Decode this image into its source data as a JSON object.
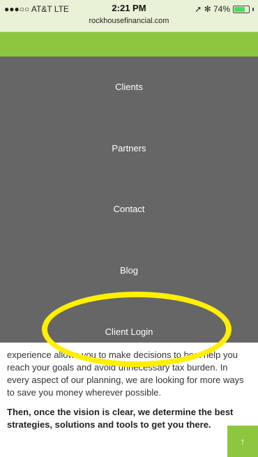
{
  "status_bar": {
    "carrier": "●●●○○ AT&T LTE",
    "time": "2:21 PM",
    "url": "rockhousefinancial.com",
    "indicators": "➚ ✻ 74%",
    "battery_percent": 74
  },
  "menu": {
    "items": [
      {
        "label": "Clients"
      },
      {
        "label": "Partners"
      },
      {
        "label": "Contact"
      },
      {
        "label": "Blog"
      },
      {
        "label": "Client Login"
      }
    ]
  },
  "content": {
    "paragraph1": "experience allows you to make decisions to best help you reach your goals and avoid unnecessary tax burden. In every aspect of our planning, we are looking for more ways to save you money wherever possible.",
    "paragraph2": "Then, once the vision is clear, we determine the best strategies, solutions and tools to get you there."
  },
  "scroll_top": {
    "icon": "↑"
  },
  "colors": {
    "brand_green": "#8dc63f",
    "menu_gray": "#666666",
    "highlight": "#ffef00"
  }
}
